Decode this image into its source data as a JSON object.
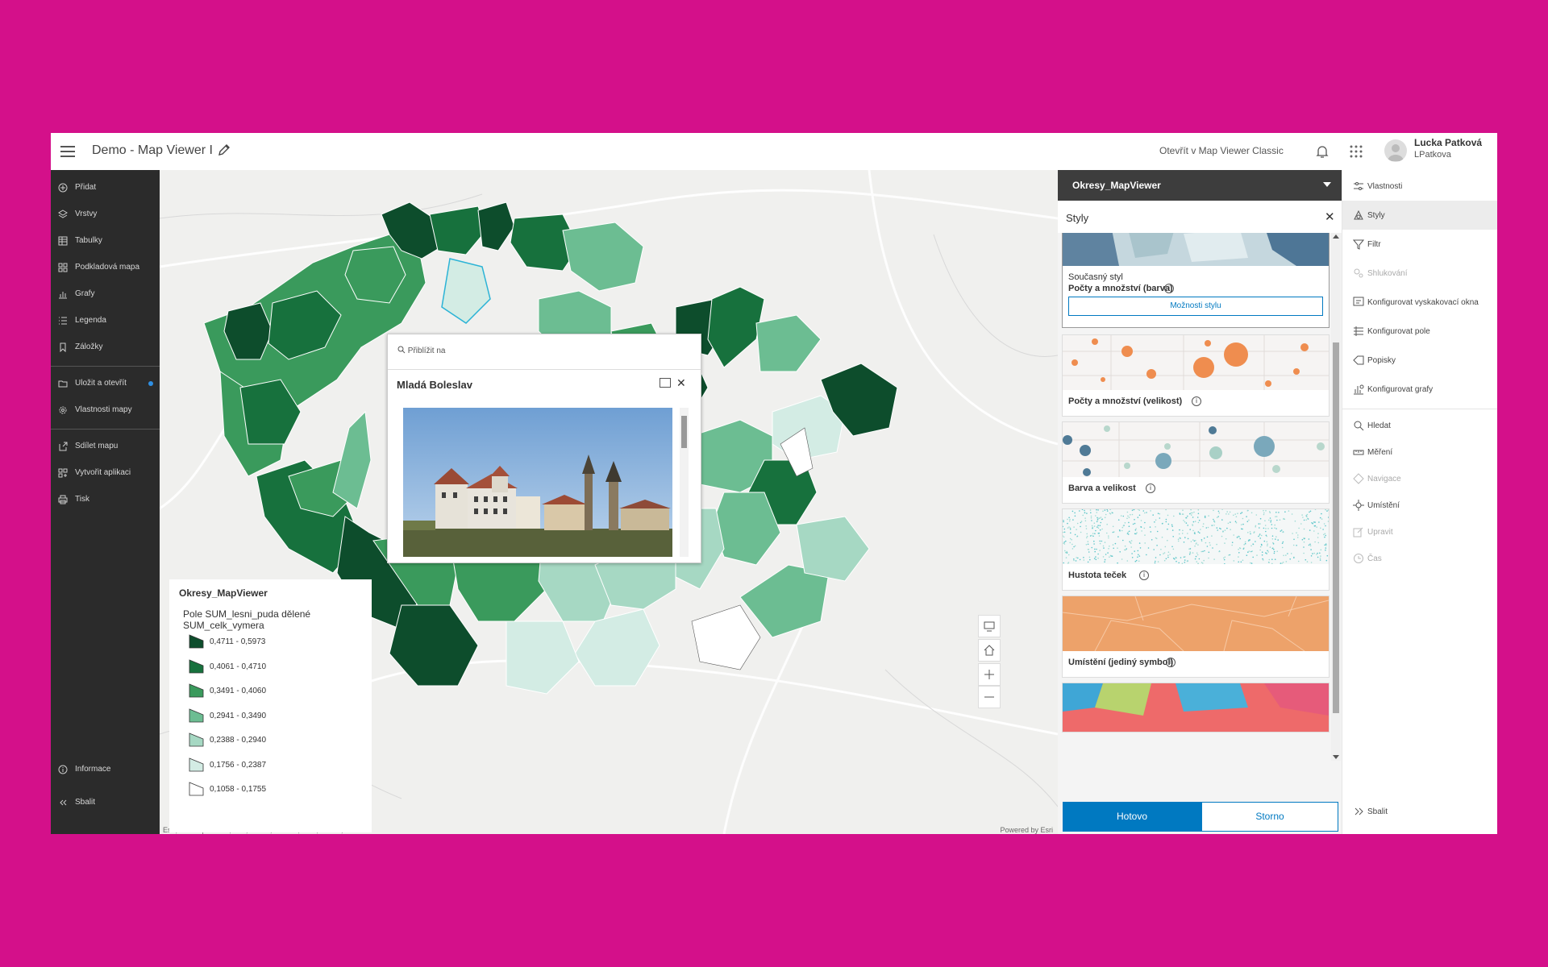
{
  "header": {
    "title": "Demo - Map Viewer I",
    "open_classic": "Otevřít v Map Viewer Classic",
    "user_name": "Lucka Patková",
    "user_login": "LPatkova"
  },
  "left_nav": {
    "items": [
      "Přidat",
      "Vrstvy",
      "Tabulky",
      "Podkladová mapa",
      "Grafy",
      "Legenda",
      "Záložky",
      "Uložit a otevřít",
      "Vlastnosti mapy",
      "Sdílet mapu",
      "Vytvořit aplikaci",
      "Tisk",
      "Informace",
      "Sbalit"
    ]
  },
  "map": {
    "attribution": "Esri, USGS | GUGIK, Esri, HERE, Garmin, FAO, NOAA, USGS",
    "powered_by": "Powered by Esri"
  },
  "legend": {
    "title": "Okresy_MapViewer",
    "subtitle": "Pole SUM_lesni_puda dělené SUM_celk_vymera",
    "classes": [
      {
        "label": "0,4711 - 0,5973",
        "color": "#0d4d2c"
      },
      {
        "label": "0,4061 - 0,4710",
        "color": "#17713d"
      },
      {
        "label": "0,3491 - 0,4060",
        "color": "#3a9a5c"
      },
      {
        "label": "0,2941 - 0,3490",
        "color": "#6cbd92"
      },
      {
        "label": "0,2388 - 0,2940",
        "color": "#a6d8c3"
      },
      {
        "label": "0,1756 - 0,2387",
        "color": "#d3ece4"
      },
      {
        "label": "0,1058 - 0,1755",
        "color": "#ffffff"
      }
    ]
  },
  "popup": {
    "zoom_to": "Přiblížit na",
    "title": "Mladá Boleslav"
  },
  "panel": {
    "layer_name": "Okresy_MapViewer",
    "section_title": "Styly",
    "current_label": "Současný styl",
    "current_style": "Počty a množství (barva)",
    "style_options": "Možnosti stylu",
    "cards": [
      "Počty a množství (velikost)",
      "Barva a velikost",
      "Hustota teček",
      "Umístění (jediný symbol)"
    ],
    "done": "Hotovo",
    "cancel": "Storno"
  },
  "right_rail": {
    "items": [
      "Vlastnosti",
      "Styly",
      "Filtr",
      "Shlukování",
      "Konfigurovat vyskakovací okna",
      "Konfigurovat pole",
      "Popisky",
      "Konfigurovat grafy",
      "Hledat",
      "Měření",
      "Navigace",
      "Umístění",
      "Upravit",
      "Čas",
      "Sbalit"
    ]
  },
  "colors": {
    "accent": "#0079c1",
    "background": "#d4108a",
    "nav_bg": "#2b2b2b"
  }
}
